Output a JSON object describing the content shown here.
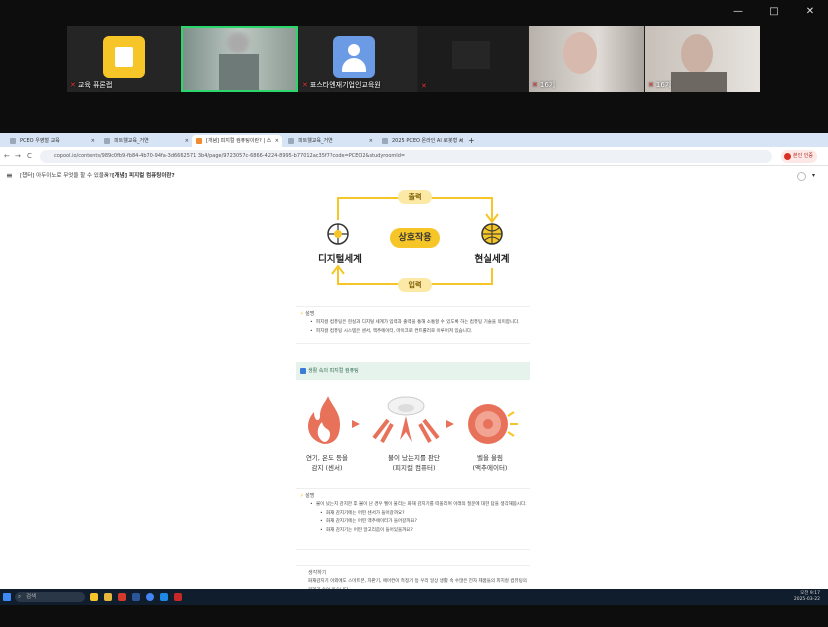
{
  "window": {
    "minimize": "—",
    "maximize": "□",
    "close": "✕"
  },
  "meeting": {
    "tiles": [
      {
        "label": "교육 퓨론랩",
        "icon": "logo-icon"
      },
      {
        "label": "",
        "icon": "person-video"
      },
      {
        "label": "표스타엔재기업인교육원",
        "icon": "avatar-icon"
      },
      {
        "label": "",
        "icon": "blank"
      },
      {
        "label": "16기",
        "icon": "person-video"
      },
      {
        "label": "16기",
        "icon": "person-video"
      }
    ]
  },
  "browser": {
    "tabs": [
      {
        "label": "PCEO 우영철 교육"
      },
      {
        "label": "피트웰교육_거연"
      },
      {
        "label": "[개념] 피지컬 컴퓨팅이란? | 스"
      },
      {
        "label": "피트웰교육_거연"
      },
      {
        "label": "2025 PCEO 온라인 AI 로봇형 시"
      }
    ],
    "new_tab": "+",
    "url": "copool.io/contents/989c0fb9-fb84-4b70-94fa-3d6662571 3b4/page/9723057c-6866-4224-8995-b77012ac35f7?code=PCEO2&studyroomId=",
    "profile": "본인 인증",
    "nav": {
      "back": "←",
      "forward": "→",
      "refresh": "C"
    }
  },
  "breadcrumb": {
    "menu": "≡",
    "item1": "[챕터] 아두이노로 무엇을 할 수 있을까?",
    "sep": ">",
    "item2": "[개념] 피지컬 컴퓨팅이란?"
  },
  "diagram": {
    "output_label": "출력",
    "input_label": "입력",
    "center_label": "상호작용",
    "left_label": "디지털세계",
    "right_label": "현실세계"
  },
  "explain1": {
    "title": "설명",
    "items": [
      "피지컬 컴퓨팅은 현실과 디지털 세계가 입력과 출력을 통해 소통할 수 있도록 하는 컴퓨팅 기술을 의미합니다.",
      "피지컬 컴퓨팅 시스템은 센서, 액추에이터, 마이크로 컨트롤러로 이루어져 있습니다."
    ]
  },
  "section": {
    "title": "생활 속의 피지컬 컴퓨팅"
  },
  "flow": [
    {
      "line1": "연기, 온도 등을",
      "line2": "감지 (센서)"
    },
    {
      "line1": "불이 났는지를 판단",
      "line2": "(피지컬 컴퓨터)"
    },
    {
      "line1": "벨을 울림",
      "line2": "(액추에이터)"
    }
  ],
  "explain2": {
    "title": "설명",
    "intro": "불이 났는지 감지한 후 불이 난 경우 벨이 울리는 화재 감지기를 떠올리며 아래의 질문에 대한 답을 생각해봅시다.",
    "items": [
      "화재 감지기에는 어떤 센서가 들어갈까요?",
      "화재 감지기에는 어떤 액추에이터가 들어갈까요?",
      "화재 감지기는 어떤 알고리즘이 들어있을까요?"
    ]
  },
  "explain3": {
    "title": "생각하기",
    "text": "화재감지기 이외에도 스마트폰, 자판기, 에어컨이 측정기 등 우리 일상 생활 속 수많은 전자 제품들의 피지컬 컴퓨팅의 원리가 숨어 있습니다."
  },
  "taskbar": {
    "search": "검색",
    "time": "오전 9:17",
    "date": "2025-03-22"
  },
  "colors": {
    "accent": "#f6c628",
    "teal": "#e8f4ef",
    "red": "#e8715a"
  }
}
